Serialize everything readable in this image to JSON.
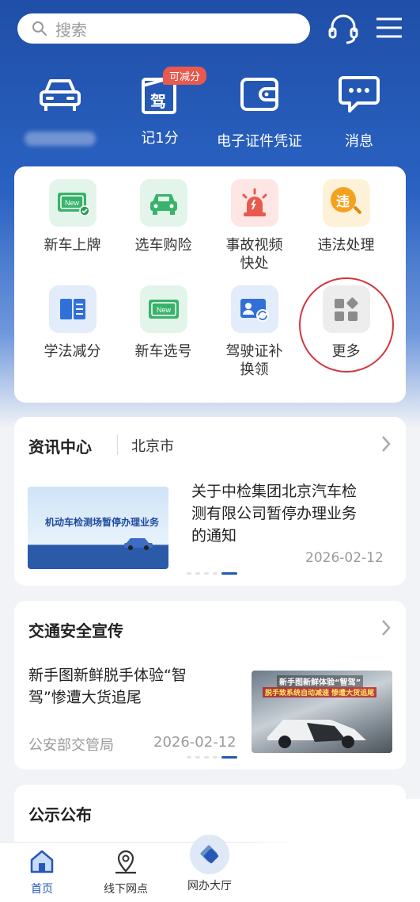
{
  "search": {
    "placeholder": "搜索",
    "icon": "search-icon"
  },
  "header_icons": [
    "headset-icon",
    "menu-icon"
  ],
  "quick": [
    {
      "icon": "car-icon",
      "label": "",
      "blurred": true
    },
    {
      "icon": "license-icon",
      "label": "记1分",
      "badge": "可减分",
      "glyph": "驾"
    },
    {
      "icon": "wallet-icon",
      "label": "电子证件凭证"
    },
    {
      "icon": "message-icon",
      "label": "消息"
    }
  ],
  "services": [
    {
      "label": "新车上牌",
      "icon": "new-plate-icon",
      "color": "#38b36a",
      "glyph": "New"
    },
    {
      "label": "选车购险",
      "icon": "car-insurance-icon",
      "color": "#38b36a"
    },
    {
      "label": "事故视频快处",
      "label_lines": [
        "事故视频",
        "快处"
      ],
      "icon": "siren-icon",
      "color": "#e8594e"
    },
    {
      "label": "违法处理",
      "icon": "violation-icon",
      "color": "#f0a020",
      "glyph": "违"
    },
    {
      "label": "学法减分",
      "icon": "book-icon",
      "color": "#3070d8"
    },
    {
      "label": "新车选号",
      "icon": "plate-number-icon",
      "color": "#38b36a",
      "glyph": "New"
    },
    {
      "label": "驾驶证补换领",
      "label_lines": [
        "驾驶证补",
        "换领"
      ],
      "icon": "license-renew-icon",
      "color": "#3070d8"
    },
    {
      "label": "更多",
      "icon": "more-grid-icon",
      "color": "#8c8c8c"
    }
  ],
  "news": {
    "title": "资讯中心",
    "city": "北京市",
    "item_title": "关于中检集团北京汽车检测有限公司暂停办理业务的通知",
    "item_lines": [
      "关于中检集团北京汽车检",
      "测有限公司暂停办理业务",
      "的通知"
    ],
    "image_text": "机动车检测场暂停办理业务",
    "date": "2026-02-12"
  },
  "safety": {
    "title": "交通安全宣传",
    "item_title": "新手图新鲜脱手体验“智驾”惨遭大货追尾",
    "item_lines": [
      "新手图新鲜脱手体验“智",
      "驾”惨遭大货追尾"
    ],
    "source": "公安部交管局",
    "date": "2026-02-12",
    "image_text": [
      "新手图新鲜体验“智驾”",
      "脱手致系统自动减速 惨遭大货追尾"
    ]
  },
  "notice": {
    "title": "公示公布"
  },
  "tabs": [
    {
      "label": "首页",
      "icon": "home-icon",
      "active": true
    },
    {
      "label": "线下网点",
      "icon": "location-icon"
    },
    {
      "label": "网办大厅",
      "icon": "hall-icon"
    }
  ],
  "colors": {
    "brand": "#2558b8",
    "alert": "#d2373b"
  }
}
